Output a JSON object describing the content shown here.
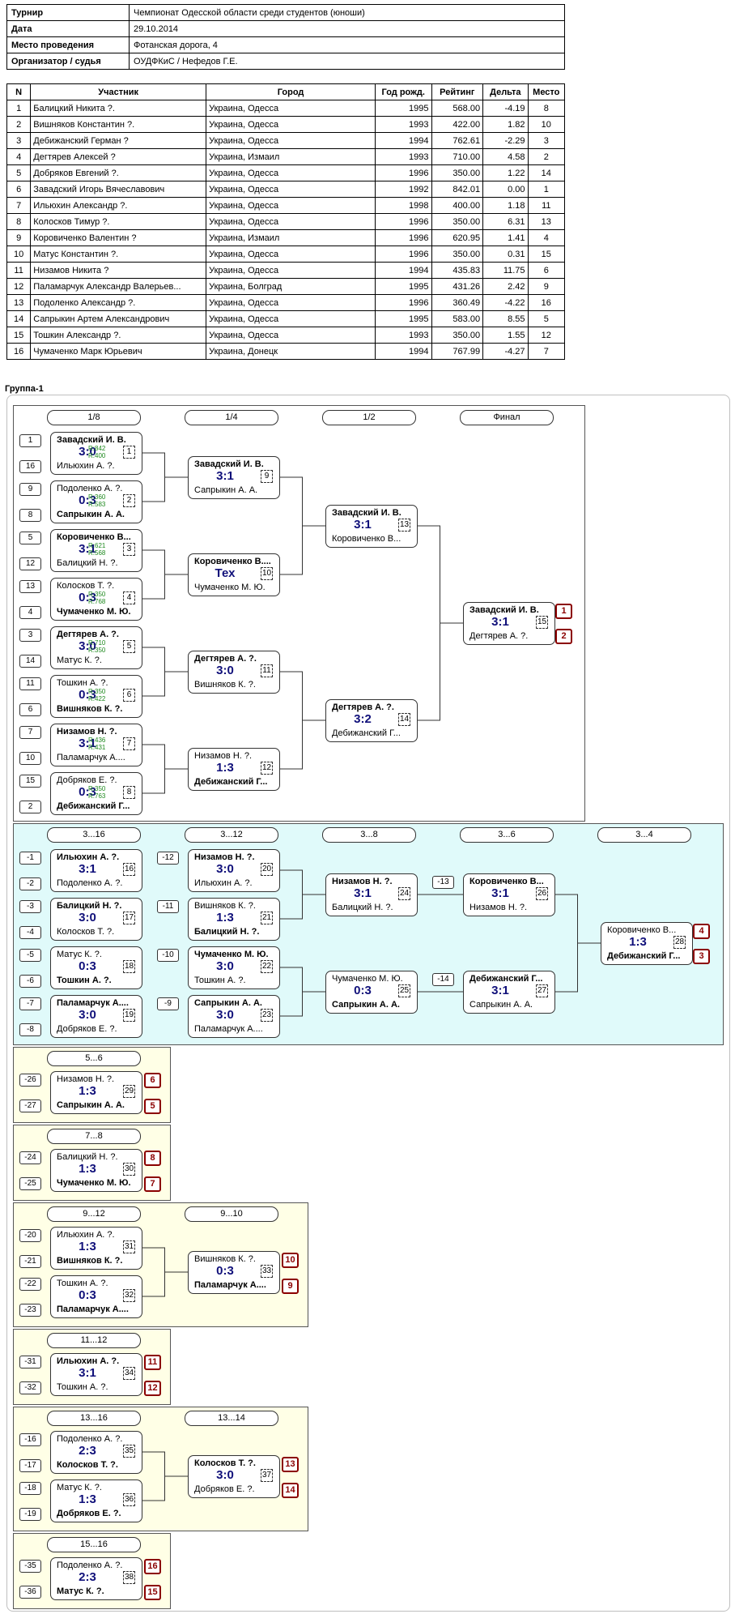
{
  "info": {
    "rows": [
      {
        "label": "Турнир",
        "value": "Чемпионат Одесской области среди студентов (юноши)"
      },
      {
        "label": "Дата",
        "value": "29.10.2014"
      },
      {
        "label": "Место проведения",
        "value": "Фотанская дорога, 4"
      },
      {
        "label": "Организатор / судья",
        "value": "ОУДФКиС / Нефедов Г.Е."
      }
    ]
  },
  "participants": {
    "headers": [
      "N",
      "Участник",
      "Город",
      "Год рожд.",
      "Рейтинг",
      "Дельта",
      "Место"
    ],
    "rows": [
      [
        "1",
        "Балицкий Никита ?.",
        "Украина, Одесса",
        "1995",
        "568.00",
        "-4.19",
        "8"
      ],
      [
        "2",
        "Вишняков Константин ?.",
        "Украина, Одесса",
        "1993",
        "422.00",
        "1.82",
        "10"
      ],
      [
        "3",
        "Дебижанский Герман ?",
        "Украина, Одесса",
        "1994",
        "762.61",
        "-2.29",
        "3"
      ],
      [
        "4",
        "Дегтярев Алексей ?",
        "Украина, Измаил",
        "1993",
        "710.00",
        "4.58",
        "2"
      ],
      [
        "5",
        "Добряков Евгений ?.",
        "Украина, Одесса",
        "1996",
        "350.00",
        "1.22",
        "14"
      ],
      [
        "6",
        "Завадский Игорь Вячеславович",
        "Украина, Одесса",
        "1992",
        "842.01",
        "0.00",
        "1"
      ],
      [
        "7",
        "Ильюхин Александр ?.",
        "Украина, Одесса",
        "1998",
        "400.00",
        "1.18",
        "11"
      ],
      [
        "8",
        "Колосков Тимур ?.",
        "Украина, Одесса",
        "1996",
        "350.00",
        "6.31",
        "13"
      ],
      [
        "9",
        "Коровиченко Валентин ?",
        "Украина, Измаил",
        "1996",
        "620.95",
        "1.41",
        "4"
      ],
      [
        "10",
        "Матус Константин ?.",
        "Украина, Одесса",
        "1996",
        "350.00",
        "0.31",
        "15"
      ],
      [
        "11",
        "Низамов Никита ?",
        "Украина, Одесса",
        "1994",
        "435.83",
        "11.75",
        "6"
      ],
      [
        "12",
        "Паламарчук Александр Валерьев...",
        "Украина, Болград",
        "1995",
        "431.26",
        "2.42",
        "9"
      ],
      [
        "13",
        "Подоленко Александр ?.",
        "Украина, Одесса",
        "1996",
        "360.49",
        "-4.22",
        "16"
      ],
      [
        "14",
        "Сапрыкин Артем Александрович",
        "Украина, Одесса",
        "1995",
        "583.00",
        "8.55",
        "5"
      ],
      [
        "15",
        "Тошкин Александр ?.",
        "Украина, Одесса",
        "1993",
        "350.00",
        "1.55",
        "12"
      ],
      [
        "16",
        "Чумаченко Марк Юрьевич",
        "Украина, Донецк",
        "1994",
        "767.99",
        "-4.27",
        "7"
      ]
    ]
  },
  "group_title": "Группа-1",
  "headers": [
    {
      "id": "h-18",
      "label": "1/8"
    },
    {
      "id": "h-14",
      "label": "1/4"
    },
    {
      "id": "h-12",
      "label": "1/2"
    },
    {
      "id": "h-final",
      "label": "Финал"
    },
    {
      "id": "h-3-16",
      "label": "3...16"
    },
    {
      "id": "h-3-12",
      "label": "3...12"
    },
    {
      "id": "h-3-8",
      "label": "3...8"
    },
    {
      "id": "h-3-6",
      "label": "3...6"
    },
    {
      "id": "h-3-4",
      "label": "3...4"
    },
    {
      "id": "h-5-6",
      "label": "5...6"
    },
    {
      "id": "h-7-8",
      "label": "7...8"
    },
    {
      "id": "h-9-12",
      "label": "9...12"
    },
    {
      "id": "h-9-10",
      "label": "9...10"
    },
    {
      "id": "h-11-12",
      "label": "11...12"
    },
    {
      "id": "h-13-16",
      "label": "13...16"
    },
    {
      "id": "h-13-14",
      "label": "13...14"
    },
    {
      "id": "h-15-16",
      "label": "15...16"
    }
  ],
  "seeds": [
    "1",
    "16",
    "9",
    "8",
    "5",
    "12",
    "13",
    "4",
    "3",
    "14",
    "11",
    "6",
    "7",
    "10",
    "15",
    "2",
    "-1",
    "-2",
    "-3",
    "-4",
    "-5",
    "-6",
    "-7",
    "-8",
    "-12",
    "-11",
    "-10",
    "-9",
    "-13",
    "-14",
    "-26",
    "-27",
    "-24",
    "-25",
    "-20",
    "-21",
    "-22",
    "-23",
    "-31",
    "-32",
    "-16",
    "-17",
    "-18",
    "-19",
    "-35",
    "-36"
  ],
  "places": [
    "1",
    "2",
    "4",
    "3",
    "6",
    "5",
    "8",
    "7",
    "10",
    "9",
    "11",
    "12",
    "13",
    "14",
    "16",
    "15"
  ],
  "matches": [
    {
      "num": "1",
      "p1": "Завадский И. В.",
      "p2": "Ильюхин А. ?.",
      "score": "3:0",
      "w": 1,
      "r1": "R:842",
      "r2": "R:400"
    },
    {
      "num": "2",
      "p1": "Подоленко А. ?.",
      "p2": "Сапрыкин А. А.",
      "score": "0:3",
      "w": 2,
      "r1": "R:360",
      "r2": "R:583"
    },
    {
      "num": "3",
      "p1": "Коровиченко В...",
      "p2": "Балицкий Н. ?.",
      "score": "3:1",
      "w": 1,
      "r1": "R:621",
      "r2": "R:568"
    },
    {
      "num": "4",
      "p1": "Колосков Т. ?.",
      "p2": "Чумаченко М. Ю.",
      "score": "0:3",
      "w": 2,
      "r1": "R:350",
      "r2": "R:768"
    },
    {
      "num": "5",
      "p1": "Дегтярев А. ?.",
      "p2": "Матус К. ?.",
      "score": "3:0",
      "w": 1,
      "r1": "R:710",
      "r2": "R:350"
    },
    {
      "num": "6",
      "p1": "Тошкин А. ?.",
      "p2": "Вишняков К. ?.",
      "score": "0:3",
      "w": 2,
      "r1": "R:350",
      "r2": "R:422"
    },
    {
      "num": "7",
      "p1": "Низамов Н. ?.",
      "p2": "Паламарчук А....",
      "score": "3:1",
      "w": 1,
      "r1": "R:436",
      "r2": "R:431"
    },
    {
      "num": "8",
      "p1": "Добряков Е. ?.",
      "p2": "Дебижанский Г...",
      "score": "0:3",
      "w": 2,
      "r1": "R:350",
      "r2": "R:763"
    },
    {
      "num": "9",
      "p1": "Завадский И. В.",
      "p2": "Сапрыкин А. А.",
      "score": "3:1",
      "w": 1
    },
    {
      "num": "10",
      "p1": "Коровиченко В....",
      "p2": "Чумаченко М. Ю.",
      "score": "Тех",
      "w": 1
    },
    {
      "num": "11",
      "p1": "Дегтярев А. ?.",
      "p2": "Вишняков К. ?.",
      "score": "3:0",
      "w": 1
    },
    {
      "num": "12",
      "p1": "Низамов Н. ?.",
      "p2": "Дебижанский Г...",
      "score": "1:3",
      "w": 2
    },
    {
      "num": "13",
      "p1": "Завадский И. В.",
      "p2": "Коровиченко В...",
      "score": "3:1",
      "w": 1
    },
    {
      "num": "14",
      "p1": "Дегтярев А. ?.",
      "p2": "Дебижанский Г...",
      "score": "3:2",
      "w": 1
    },
    {
      "num": "15",
      "p1": "Завадский И. В.",
      "p2": "Дегтярев А. ?.",
      "score": "3:1",
      "w": 1
    },
    {
      "num": "16",
      "p1": "Ильюхин А. ?.",
      "p2": "Подоленко А. ?.",
      "score": "3:1",
      "w": 1
    },
    {
      "num": "17",
      "p1": "Балицкий Н. ?.",
      "p2": "Колосков Т. ?.",
      "score": "3:0",
      "w": 1
    },
    {
      "num": "18",
      "p1": "Матус К. ?.",
      "p2": "Тошкин А. ?.",
      "score": "0:3",
      "w": 2
    },
    {
      "num": "19",
      "p1": "Паламарчук А....",
      "p2": "Добряков Е. ?.",
      "score": "3:0",
      "w": 1
    },
    {
      "num": "20",
      "p1": "Низамов Н. ?.",
      "p2": "Ильюхин А. ?.",
      "score": "3:0",
      "w": 1
    },
    {
      "num": "21",
      "p1": "Вишняков К. ?.",
      "p2": "Балицкий Н. ?.",
      "score": "1:3",
      "w": 2
    },
    {
      "num": "22",
      "p1": "Чумаченко М. Ю.",
      "p2": "Тошкин А. ?.",
      "score": "3:0",
      "w": 1
    },
    {
      "num": "23",
      "p1": "Сапрыкин А. А.",
      "p2": "Паламарчук А....",
      "score": "3:0",
      "w": 1
    },
    {
      "num": "24",
      "p1": "Низамов Н. ?.",
      "p2": "Балицкий Н. ?.",
      "score": "3:1",
      "w": 1
    },
    {
      "num": "25",
      "p1": "Чумаченко М. Ю.",
      "p2": "Сапрыкин А. А.",
      "score": "0:3",
      "w": 2
    },
    {
      "num": "26",
      "p1": "Коровиченко В...",
      "p2": "Низамов Н. ?.",
      "score": "3:1",
      "w": 1
    },
    {
      "num": "27",
      "p1": "Дебижанский Г...",
      "p2": "Сапрыкин А. А.",
      "score": "3:1",
      "w": 1
    },
    {
      "num": "28",
      "p1": "Коровиченко В...",
      "p2": "Дебижанский Г...",
      "score": "1:3",
      "w": 2
    },
    {
      "num": "29",
      "p1": "Низамов Н. ?.",
      "p2": "Сапрыкин А. А.",
      "score": "1:3",
      "w": 2
    },
    {
      "num": "30",
      "p1": "Балицкий Н. ?.",
      "p2": "Чумаченко М. Ю.",
      "score": "1:3",
      "w": 2
    },
    {
      "num": "31",
      "p1": "Ильюхин А. ?.",
      "p2": "Вишняков К. ?.",
      "score": "1:3",
      "w": 2
    },
    {
      "num": "32",
      "p1": "Тошкин А. ?.",
      "p2": "Паламарчук А....",
      "score": "0:3",
      "w": 2
    },
    {
      "num": "33",
      "p1": "Вишняков К. ?.",
      "p2": "Паламарчук А....",
      "score": "0:3",
      "w": 2
    },
    {
      "num": "34",
      "p1": "Ильюхин А. ?.",
      "p2": "Тошкин А. ?.",
      "score": "3:1",
      "w": 1
    },
    {
      "num": "35",
      "p1": "Подоленко А. ?.",
      "p2": "Колосков Т. ?.",
      "score": "2:3",
      "w": 2
    },
    {
      "num": "36",
      "p1": "Матус К. ?.",
      "p2": "Добряков Е. ?.",
      "score": "1:3",
      "w": 2
    },
    {
      "num": "37",
      "p1": "Колосков Т. ?.",
      "p2": "Добряков Е. ?.",
      "score": "3:0",
      "w": 1
    },
    {
      "num": "38",
      "p1": "Подоленко А. ?.",
      "p2": "Матус К. ?.",
      "score": "2:3",
      "w": 2
    }
  ],
  "colors": {
    "panel_main": "#ffffff",
    "panel_cyan": "#e0fafa",
    "panel_yellow": "#ffffe6",
    "score": "#10107a",
    "rating": "#1f8a1f",
    "place_border": "#8b0000"
  }
}
